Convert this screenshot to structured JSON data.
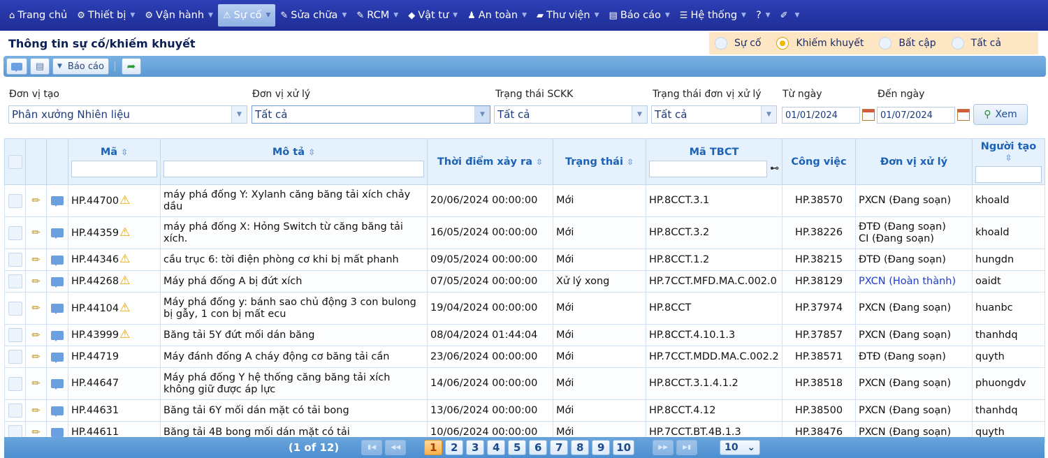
{
  "menu": [
    {
      "icon": "home-icon",
      "glyph": "⌂",
      "label": "Trang chủ",
      "caret": false
    },
    {
      "icon": "equipment-icon",
      "glyph": "⚙",
      "label": "Thiết bị",
      "caret": true
    },
    {
      "icon": "operation-icon",
      "glyph": "⚙",
      "label": "Vận hành",
      "caret": true
    },
    {
      "icon": "warning-icon",
      "glyph": "⚠",
      "label": "Sự cố",
      "caret": true,
      "active": true
    },
    {
      "icon": "wrench-icon",
      "glyph": "✎",
      "label": "Sửa chữa",
      "caret": true
    },
    {
      "icon": "rcm-icon",
      "glyph": "✎",
      "label": "RCM",
      "caret": true
    },
    {
      "icon": "materials-icon",
      "glyph": "◆",
      "label": "Vật tư",
      "caret": true
    },
    {
      "icon": "safety-icon",
      "glyph": "♟",
      "label": "An toàn",
      "caret": true
    },
    {
      "icon": "library-icon",
      "glyph": "▰",
      "label": "Thư viện",
      "caret": true
    },
    {
      "icon": "report-icon",
      "glyph": "▤",
      "label": "Báo cáo",
      "caret": true
    },
    {
      "icon": "system-icon",
      "glyph": "☰",
      "label": "Hệ thống",
      "caret": true
    },
    {
      "icon": "help-icon",
      "glyph": "",
      "label": "?",
      "caret": true
    },
    {
      "icon": "brush-icon",
      "glyph": "✐",
      "label": "",
      "caret": true
    }
  ],
  "page": {
    "title": "Thông tin sự cố/khiếm khuyết"
  },
  "type_filter": {
    "options": [
      "Sự cố",
      "Khiếm khuyết",
      "Bất cập",
      "Tất cả"
    ],
    "selected": "Khiếm khuyết"
  },
  "toolbar": {
    "report_label": "Báo cáo"
  },
  "filters": {
    "created_unit_label": "Đơn vị tạo",
    "created_unit_value": "Phân xưởng Nhiên liệu",
    "handling_unit_label": "Đơn vị xử lý",
    "handling_unit_value": "Tất cả",
    "status_label": "Trạng thái SCKK",
    "status_value": "Tất cả",
    "unit_status_label": "Trạng thái đơn vị xử lý",
    "unit_status_value": "Tất cả",
    "from_label": "Từ ngày",
    "from_value": "01/01/2024",
    "to_label": "Đến ngày",
    "to_value": "01/07/2024",
    "view_label": "Xem"
  },
  "table": {
    "headers": {
      "code": "Mã",
      "description": "Mô tả",
      "time": "Thời điểm xảy ra",
      "status": "Trạng thái",
      "tbct": "Mã TBCT",
      "job": "Công việc",
      "unit": "Đơn vị xử lý",
      "creator": "Người tạo"
    },
    "rows": [
      {
        "code": "HP.44700",
        "warn": true,
        "desc": "máy phá đống Y: Xylanh căng băng tải xích chảy dầu",
        "time": "20/06/2024 00:00:00",
        "status": "Mới",
        "tbct": "HP.8CCT.3.1",
        "job": "HP.38570",
        "unit": "PXCN (Đang soạn)",
        "unit2": "",
        "done": false,
        "creator": "khoald"
      },
      {
        "code": "HP.44359",
        "warn": true,
        "desc": "máy phá đống X: Hỏng Switch từ căng băng tải xích.",
        "time": "16/05/2024 00:00:00",
        "status": "Mới",
        "tbct": "HP.8CCT.3.2",
        "job": "HP.38226",
        "unit": "ĐTĐ (Đang soạn)",
        "unit2": "CI (Đang soạn)",
        "done": false,
        "creator": "khoald"
      },
      {
        "code": "HP.44346",
        "warn": true,
        "desc": "cầu trục 6: tời điện phòng cơ khi bị mất phanh",
        "time": "09/05/2024 00:00:00",
        "status": "Mới",
        "tbct": "HP.8CCT.1.2",
        "job": "HP.38215",
        "unit": "ĐTĐ (Đang soạn)",
        "unit2": "",
        "done": false,
        "creator": "hungdn"
      },
      {
        "code": "HP.44268",
        "warn": true,
        "desc": "Máy phá đống A bị đứt xích",
        "time": "07/05/2024 00:00:00",
        "status": "Xử lý xong",
        "tbct": "HP.7CCT.MFD.MA.C.002.0",
        "job": "HP.38129",
        "unit": "PXCN (Hoàn thành)",
        "unit2": "",
        "done": true,
        "creator": "oaidt"
      },
      {
        "code": "HP.44104",
        "warn": true,
        "desc": "Máy phá đống y: bánh sao chủ động 3 con bulong bị gẫy, 1 con bị mất ecu",
        "time": "19/04/2024 00:00:00",
        "status": "Mới",
        "tbct": "HP.8CCT",
        "job": "HP.37974",
        "unit": "PXCN (Đang soạn)",
        "unit2": "",
        "done": false,
        "creator": "huanbc"
      },
      {
        "code": "HP.43999",
        "warn": true,
        "desc": "Băng tải 5Y đứt mối dán băng",
        "time": "08/04/2024 01:44:04",
        "status": "Mới",
        "tbct": "HP.8CCT.4.10.1.3",
        "job": "HP.37857",
        "unit": "PXCN (Đang soạn)",
        "unit2": "",
        "done": false,
        "creator": "thanhdq"
      },
      {
        "code": "HP.44719",
        "warn": false,
        "desc": "Máy đánh đống A cháy động cơ băng tải cần",
        "time": "23/06/2024 00:00:00",
        "status": "Mới",
        "tbct": "HP.7CCT.MDD.MA.C.002.2",
        "job": "HP.38571",
        "unit": "ĐTĐ (Đang soạn)",
        "unit2": "",
        "done": false,
        "creator": "quyth"
      },
      {
        "code": "HP.44647",
        "warn": false,
        "desc": "Máy phá đống Y hệ thống căng băng tải xích không giữ được áp lực",
        "time": "14/06/2024 00:00:00",
        "status": "Mới",
        "tbct": "HP.8CCT.3.1.4.1.2",
        "job": "HP.38518",
        "unit": "PXCN (Đang soạn)",
        "unit2": "",
        "done": false,
        "creator": "phuongdv"
      },
      {
        "code": "HP.44631",
        "warn": false,
        "desc": "Băng tải 6Y mối dán mặt có tải bong",
        "time": "13/06/2024 00:00:00",
        "status": "Mới",
        "tbct": "HP.8CCT.4.12",
        "job": "HP.38500",
        "unit": "PXCN (Đang soạn)",
        "unit2": "",
        "done": false,
        "creator": "thanhdq"
      },
      {
        "code": "HP.44611",
        "warn": false,
        "desc": "Băng tải 4B bong mối dán mặt có tải",
        "time": "10/06/2024 00:00:00",
        "status": "Mới",
        "tbct": "HP.7CCT.BT.4B.1.3",
        "job": "HP.38476",
        "unit": "PXCN (Đang soạn)",
        "unit2": "",
        "done": false,
        "creator": "quyth"
      }
    ]
  },
  "pager": {
    "info": "(1 of 12)",
    "pages": [
      "1",
      "2",
      "3",
      "4",
      "5",
      "6",
      "7",
      "8",
      "9",
      "10"
    ],
    "current": "1",
    "page_size": "10"
  },
  "colors": {
    "menu_bg": "#1e2d96",
    "header_text": "#1c62b6",
    "link_done": "#1f3ecb",
    "warn": "#e5a600"
  }
}
